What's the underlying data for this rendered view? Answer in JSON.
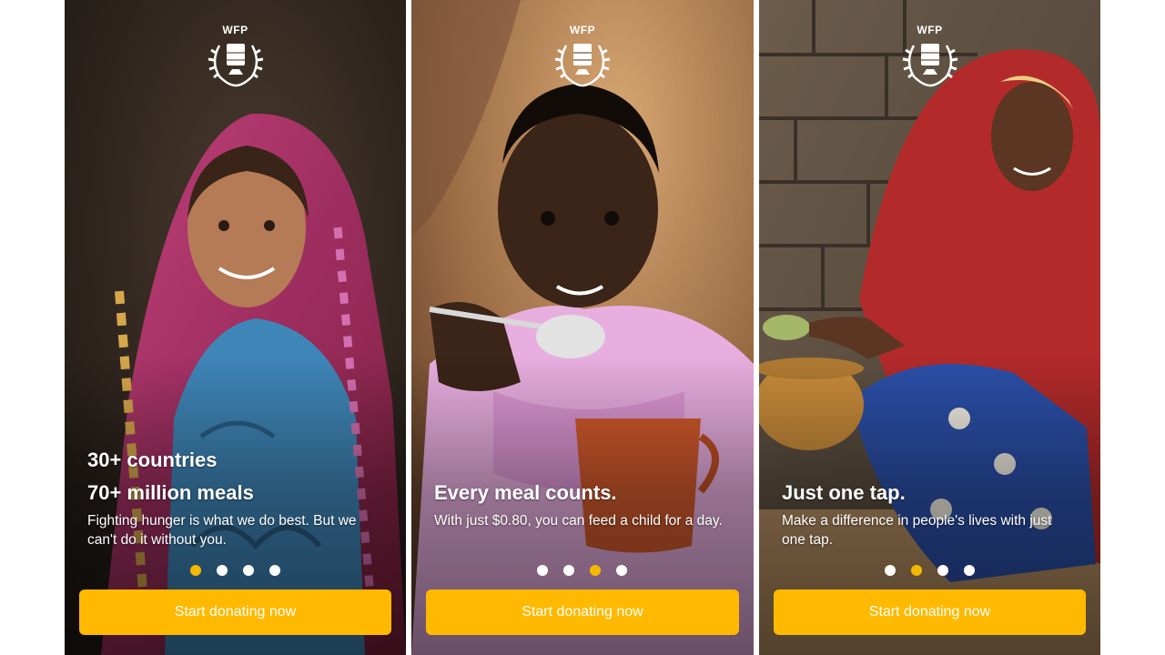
{
  "brand": {
    "logo_text": "WFP",
    "accent_color": "#ffb900",
    "active_dot_color": "#f5b800"
  },
  "screens": [
    {
      "headline_lines": [
        "30+ countries",
        "70+ million meals"
      ],
      "body": "Fighting hunger is what we do best. But we can't do it without you.",
      "button_label": "Start donating now",
      "page_indicator": {
        "count": 4,
        "active_index": 0
      }
    },
    {
      "headline_lines": [
        "Every meal counts."
      ],
      "body": "With just $0.80, you can feed a child for a day.",
      "button_label": "Start donating now",
      "page_indicator": {
        "count": 4,
        "active_index": 2
      }
    },
    {
      "headline_lines": [
        "Just one tap."
      ],
      "body": "Make a difference in people's lives with just one tap.",
      "button_label": "Start donating now",
      "page_indicator": {
        "count": 4,
        "active_index": 1
      }
    }
  ]
}
